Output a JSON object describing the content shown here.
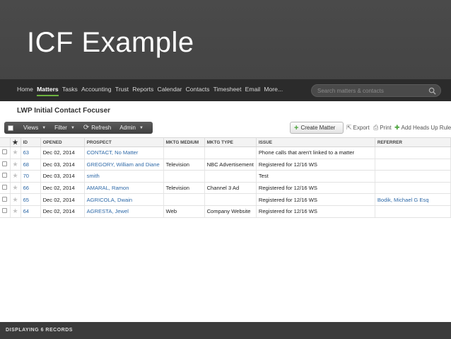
{
  "slide": {
    "title": "ICF Example"
  },
  "nav": {
    "links": [
      "Home",
      "Matters",
      "Tasks",
      "Accounting",
      "Trust",
      "Reports",
      "Calendar",
      "Contacts",
      "Timesheet",
      "Email",
      "More..."
    ],
    "active": "Matters",
    "search_placeholder": "Search matters & contacts"
  },
  "page": {
    "title": "LWP Initial Contact Focuser"
  },
  "toolbar": {
    "views": "Views",
    "filter": "Filter",
    "refresh": "Refresh",
    "admin": "Admin",
    "create_matter": "Create Matter",
    "export": "Export",
    "print": "Print",
    "add_heads_up": "Add Heads Up Rule"
  },
  "table": {
    "columns": [
      "ID",
      "OPENED",
      "PROSPECT",
      "MKTG MEDIUM",
      "MKTG TYPE",
      "ISSUE",
      "REFERRER"
    ],
    "rows": [
      {
        "id": "63",
        "opened": "Dec 02, 2014",
        "prospect": "CONTACT, No Matter",
        "medium": "",
        "type": "",
        "issue": "Phone calls that aren't linked to a matter",
        "referrer": ""
      },
      {
        "id": "68",
        "opened": "Dec 03, 2014",
        "prospect": "GREGORY, William and Diane",
        "medium": "Television",
        "type": "NBC Advertisement",
        "issue": "Registered for 12/16 WS",
        "referrer": ""
      },
      {
        "id": "70",
        "opened": "Dec 03, 2014",
        "prospect": "smith",
        "medium": "",
        "type": "",
        "issue": "Test",
        "referrer": ""
      },
      {
        "id": "66",
        "opened": "Dec 02, 2014",
        "prospect": "AMARAL, Ramon",
        "medium": "Television",
        "type": "Channel 3 Ad",
        "issue": "Registered for 12/16 WS",
        "referrer": ""
      },
      {
        "id": "65",
        "opened": "Dec 02, 2014",
        "prospect": "AGRICOLA, Dwain",
        "medium": "",
        "type": "",
        "issue": "Registered for 12/16 WS",
        "referrer": "Bodik, Michael G Esq"
      },
      {
        "id": "64",
        "opened": "Dec 02, 2014",
        "prospect": "AGRESTA, Jewel",
        "medium": "Web",
        "type": "Company Website",
        "issue": "Registered for 12/16 WS",
        "referrer": ""
      }
    ]
  },
  "footer": {
    "status": "DISPLAYING 6 RECORDS"
  },
  "colors": {
    "accent": "#6db33f",
    "link": "#2f6aa8",
    "nav_bg": "#2b2b2b"
  }
}
